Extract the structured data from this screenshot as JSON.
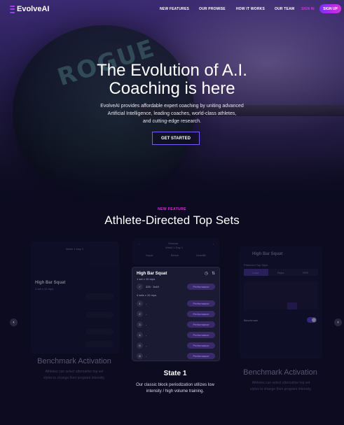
{
  "brand": {
    "name": "EvolveAI",
    "accent": "#d431d8",
    "accent2": "#7b2ff5"
  },
  "nav": {
    "links": [
      "NEW FEATURES",
      "OUR PROMISE",
      "HOW IT WORKS",
      "OUR TEAM"
    ],
    "sign_in": "SIGN IN",
    "sign_up": "SIGN UP"
  },
  "hero": {
    "title_line1": "The Evolution of A.I.",
    "title_line2": "Coaching is here",
    "subtitle_line1": "EvolveAI provides affordable expert coaching by uniting advanced",
    "subtitle_line2": "Artificial Intelligence, leading coaches, world-class athletes,",
    "subtitle_line3": "and cutting-edge research.",
    "cta": "GET STARTED"
  },
  "feature": {
    "eyebrow": "NEW FEATURE",
    "title": "Athlete-Directed Top Sets"
  },
  "center_card": {
    "week_small": "Session",
    "week_label": "Week 1 Day 1",
    "tabs": [
      "Squat",
      "Bench",
      "Deadlift"
    ],
    "exercise": "High Bar Squat",
    "prescription": "1 set x 10 reps",
    "top_row_value": "225 · 3x10",
    "top_row_btn": "Performance",
    "backoff_label": "4 sets x 10 reps",
    "rows": [
      "1",
      "2",
      "3",
      "4",
      "5",
      "6"
    ],
    "row_dash": "-",
    "row_btn": "Performance"
  },
  "left_card": {
    "week_label": "Week 1 Day 1",
    "exercise": "High Bar Squat",
    "prescription": "1 set x 10 reps",
    "title": "Benchmark Activation",
    "desc_line1": "Athletes can select alternative top set",
    "desc_line2": "styles to change their program intensity."
  },
  "right_card": {
    "exercise": "High Bar Squat",
    "label": "Preferred Top Style",
    "options": [
      "Load",
      "Reps",
      "RPE"
    ],
    "benchmark_label": "Benchmark",
    "title": "Benchmark Activation",
    "desc_line1": "Athletes can select alternative top set",
    "desc_line2": "styles to change their program intensity."
  },
  "state": {
    "title": "State 1",
    "desc_line1": "Our classic block periodization utilizes low",
    "desc_line2": "intensity / high volume training."
  },
  "carousel": {
    "prev": "‹",
    "next": "›"
  }
}
